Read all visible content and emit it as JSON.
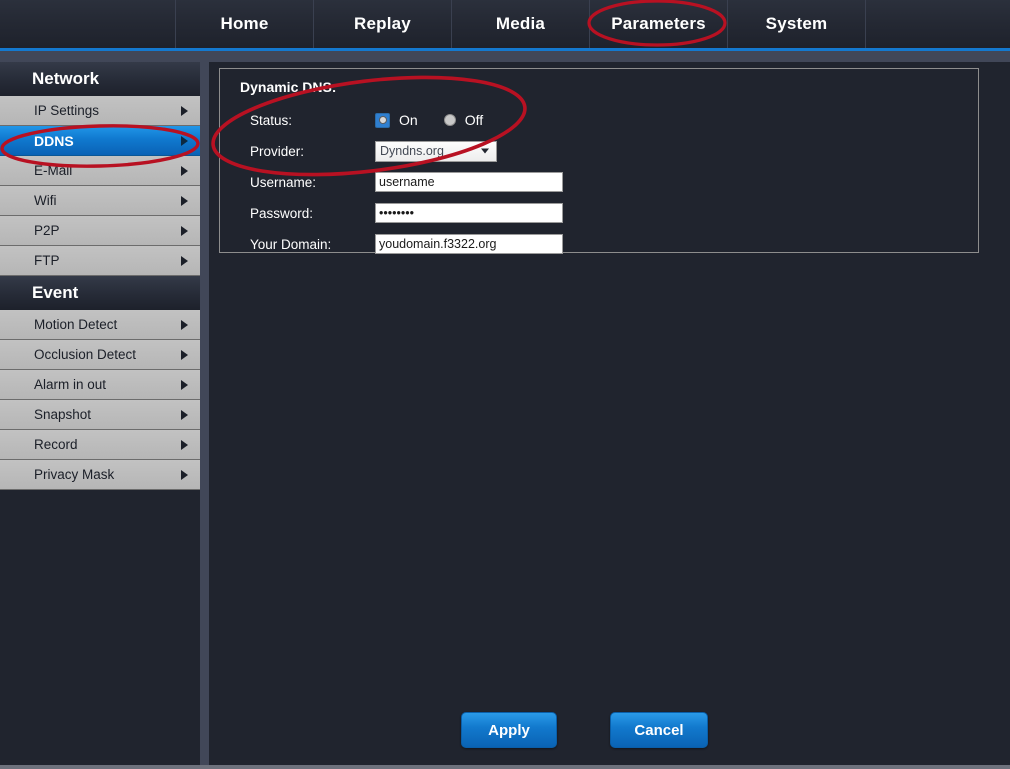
{
  "topnav": {
    "items": [
      {
        "label": "Home",
        "active": false
      },
      {
        "label": "Replay",
        "active": false
      },
      {
        "label": "Media",
        "active": false
      },
      {
        "label": "Parameters",
        "active": true
      },
      {
        "label": "System",
        "active": false
      }
    ]
  },
  "sidebar": {
    "groups": [
      {
        "header": "Network",
        "items": [
          {
            "label": "IP Settings",
            "active": false
          },
          {
            "label": "DDNS",
            "active": true
          },
          {
            "label": "E-Mail",
            "active": false
          },
          {
            "label": "Wifi",
            "active": false
          },
          {
            "label": "P2P",
            "active": false
          },
          {
            "label": "FTP",
            "active": false
          }
        ]
      },
      {
        "header": "Event",
        "items": [
          {
            "label": "Motion Detect",
            "active": false
          },
          {
            "label": "Occlusion Detect",
            "active": false
          },
          {
            "label": "Alarm in out",
            "active": false
          },
          {
            "label": "Snapshot",
            "active": false
          },
          {
            "label": "Record",
            "active": false
          },
          {
            "label": "Privacy Mask",
            "active": false
          }
        ]
      }
    ]
  },
  "panel": {
    "title": "Dynamic DNS:",
    "status": {
      "label": "Status:",
      "on_label": "On",
      "off_label": "Off",
      "selected": "On"
    },
    "provider": {
      "label": "Provider:",
      "value": "Dyndns.org"
    },
    "username": {
      "label": "Username:",
      "value": "username"
    },
    "password": {
      "label": "Password:",
      "value": "••••••••"
    },
    "domain": {
      "label": "Your Domain:",
      "value": "youdomain.f3322.org"
    }
  },
  "buttons": {
    "apply": "Apply",
    "cancel": "Cancel"
  },
  "annotations": {
    "color": "#b81122",
    "shapes": [
      "ellipse-parameters-tab",
      "ellipse-ddns-sidebar",
      "ellipse-ddns-status-provider"
    ]
  },
  "colors": {
    "accent_blue": "#1479cf",
    "nav_dark": "#242833",
    "sidebar_item": "#b9b9b9",
    "annotation_red": "#b81122"
  }
}
